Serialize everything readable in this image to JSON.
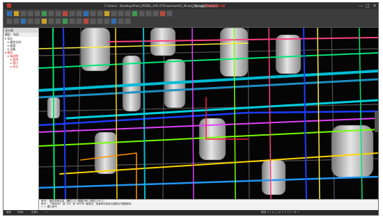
{
  "app": {
    "title": "C:\\Users\\...\\Desktop\\Plant_MODEL_V05.07\\Flowsheet\\03_Model_fin.dwg",
    "help_text": "□ 输入关键字或短语",
    "highlight_text": "PROCESS 3D",
    "window_buttons": [
      "—",
      "□",
      "✕"
    ]
  },
  "left_panel": {
    "header": "设计器",
    "tabs": [
      "模型",
      "布局"
    ],
    "tree": [
      {
        "label": "▾ 设计",
        "level": 0,
        "red": false
      },
      {
        "label": "▸ 模型空间",
        "level": 1,
        "red": false
      },
      {
        "label": "▸ 管道",
        "level": 1,
        "red": false
      },
      {
        "label": "▸ 设备",
        "level": 1,
        "red": false
      },
      {
        "label": "▾ 模型",
        "level": 0,
        "red": true
      },
      {
        "label": "▸ 轴测图",
        "level": 1,
        "red": true
      },
      {
        "label": "▸ 管线",
        "level": 2,
        "red": true
      },
      {
        "label": "▸ 视口",
        "level": 2,
        "red": true
      },
      {
        "label": "▸ 标注",
        "level": 2,
        "red": true
      }
    ]
  },
  "command": {
    "lines": [
      "命令: 指定对角点或 [栅栏(F)/圈围(WP)/圈交(CP)]:",
      "命令: _3DORBIT 按 ESC 或 ENTER 键退出，或者单击鼠标右键显示快捷菜单。",
      "✕ ▸ 键入命令"
    ]
  },
  "statusbar": {
    "items": [
      "模型",
      "布局1",
      "布局2",
      "+",
      "模型 ≡ • ∠ □ ≡ ↕ ✦ 1:1 • ⚙ +"
    ]
  },
  "viewport": {
    "label": "3D plant model view"
  }
}
